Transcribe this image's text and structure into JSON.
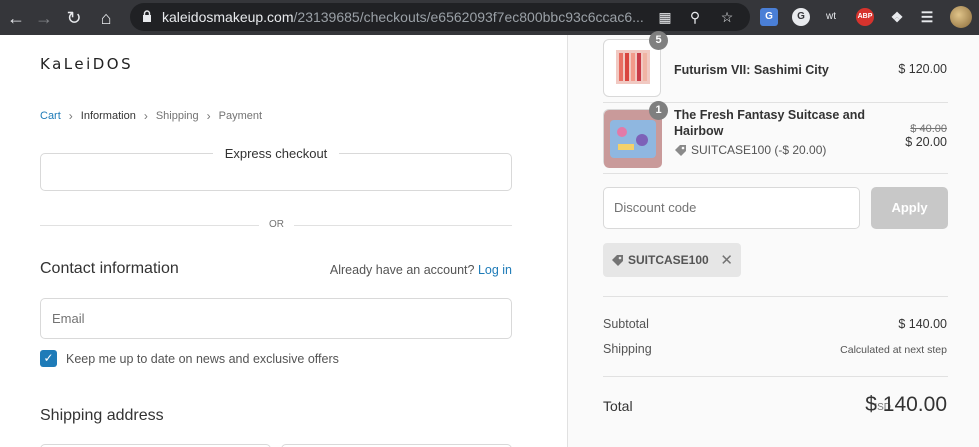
{
  "browser": {
    "url_host": "kaleidosmakeup.com",
    "url_path": "/23139685/checkouts/e6562093f7ec800bbc93c6ccac6..."
  },
  "store": {
    "logo": "KaLeiDOS"
  },
  "breadcrumb": {
    "cart": "Cart",
    "information": "Information",
    "shipping": "Shipping",
    "payment": "Payment"
  },
  "express": {
    "label": "Express checkout"
  },
  "divider_or": "OR",
  "contact": {
    "heading": "Contact information",
    "account_prompt": "Already have an account?",
    "login_link": "Log in",
    "email_placeholder": "Email",
    "newsletter_label": "Keep me up to date on news and exclusive offers",
    "newsletter_checked": true
  },
  "shipping_address": {
    "heading": "Shipping address"
  },
  "order": {
    "items": [
      {
        "name": "Futurism VII: Sashimi City",
        "quantity": "5",
        "price": "$ 120.00"
      },
      {
        "name": "The Fresh Fantasy Suitcase and Hairbow",
        "quantity": "1",
        "original_price": "$ 40.00",
        "price": "$ 20.00",
        "discount": "SUITCASE100 (-$ 20.00)"
      }
    ],
    "discount_placeholder": "Discount code",
    "apply_label": "Apply",
    "applied_code": "SUITCASE100",
    "subtotal_label": "Subtotal",
    "subtotal": "$ 140.00",
    "shipping_label": "Shipping",
    "shipping_value": "Calculated at next step",
    "total_label": "Total",
    "currency": "USD",
    "total": "$ 140.00"
  },
  "colors": {
    "accent": "#1e7bb8",
    "chrome": "#35363a"
  }
}
